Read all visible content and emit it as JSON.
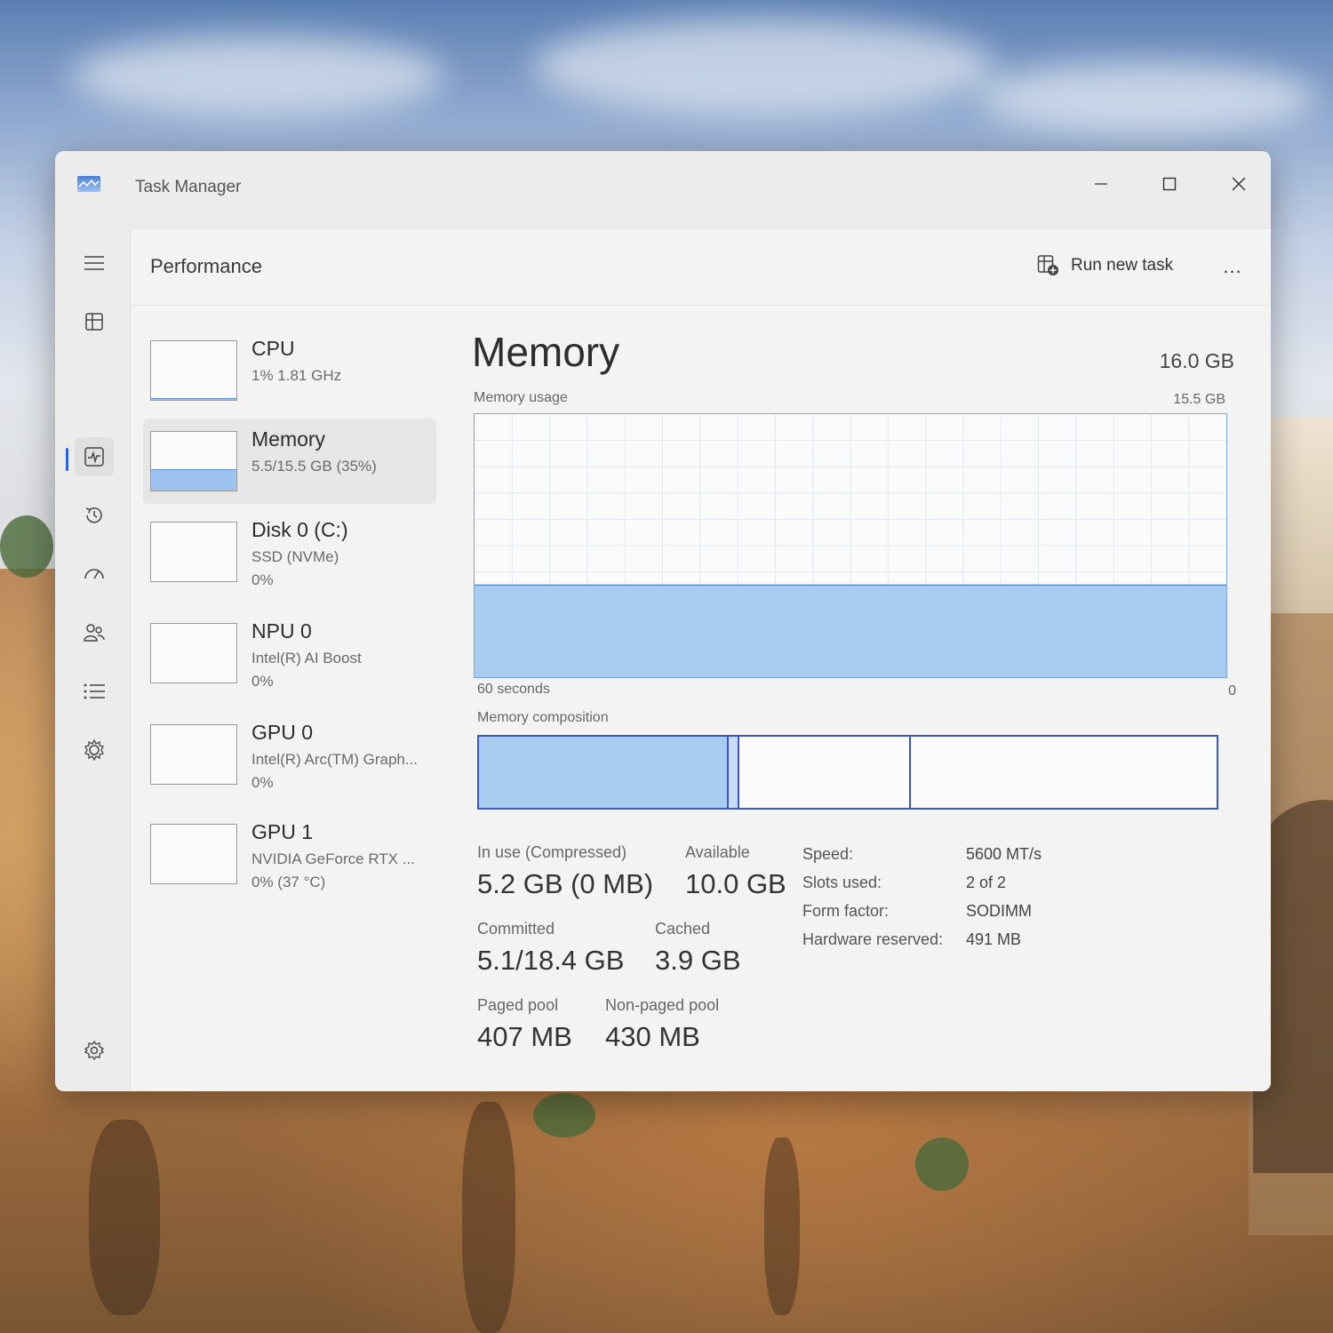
{
  "window": {
    "title": "Task Manager",
    "controls": {
      "minimize": "minimize",
      "maximize": "maximize",
      "close": "close"
    }
  },
  "nav": {
    "items": [
      {
        "icon": "hamburger-menu-icon"
      },
      {
        "icon": "processes-icon"
      },
      {
        "icon": "performance-icon",
        "active": true
      },
      {
        "icon": "app-history-icon"
      },
      {
        "icon": "startup-apps-icon"
      },
      {
        "icon": "users-icon"
      },
      {
        "icon": "details-icon"
      },
      {
        "icon": "services-icon"
      },
      {
        "icon": "settings-icon"
      }
    ]
  },
  "header": {
    "page_title": "Performance",
    "run_new_task": "Run new task",
    "more": "..."
  },
  "resources": [
    {
      "name": "CPU",
      "sub": "1%  1.81 GHz",
      "sub2": "",
      "usage_fraction": 0.01
    },
    {
      "name": "Memory",
      "sub": "5.5/15.5 GB (35%)",
      "sub2": "",
      "usage_fraction": 0.35,
      "selected": true
    },
    {
      "name": "Disk 0 (C:)",
      "sub": "SSD (NVMe)",
      "sub2": "0%",
      "usage_fraction": 0.0
    },
    {
      "name": "NPU 0",
      "sub": "Intel(R) AI Boost",
      "sub2": "0%",
      "usage_fraction": 0.0
    },
    {
      "name": "GPU 0",
      "sub": "Intel(R) Arc(TM) Graph...",
      "sub2": "0%",
      "usage_fraction": 0.0
    },
    {
      "name": "GPU 1",
      "sub": "NVIDIA GeForce RTX ...",
      "sub2": "0%  (37 °C)",
      "usage_fraction": 0.0
    }
  ],
  "memory": {
    "title": "Memory",
    "total": "16.0 GB",
    "usage_label": "Memory usage",
    "usage_max": "15.5 GB",
    "time_left": "60 seconds",
    "time_right": "0",
    "usage_fraction": 0.35,
    "composition_label": "Memory composition",
    "composition": {
      "in_use_fraction": 0.336,
      "modified_fraction": 0.017,
      "standby_fraction": 0.232,
      "free_fraction": 0.415
    },
    "stats": {
      "in_use_label": "In use (Compressed)",
      "in_use_value": "5.2 GB (0 MB)",
      "available_label": "Available",
      "available_value": "10.0 GB",
      "committed_label": "Committed",
      "committed_value": "5.1/18.4 GB",
      "cached_label": "Cached",
      "cached_value": "3.9 GB",
      "paged_label": "Paged pool",
      "paged_value": "407 MB",
      "nonpaged_label": "Non-paged pool",
      "nonpaged_value": "430 MB"
    },
    "specs": {
      "speed_label": "Speed:",
      "speed_value": "5600 MT/s",
      "slots_label": "Slots used:",
      "slots_value": "2 of 2",
      "form_label": "Form factor:",
      "form_value": "SODIMM",
      "hw_label": "Hardware reserved:",
      "hw_value": "491 MB"
    }
  },
  "colors": {
    "accent": "#2b64d9",
    "graph_fill": "#a8cbf0",
    "graph_line": "#5d8fd0",
    "composition_border": "#3a56c8"
  }
}
